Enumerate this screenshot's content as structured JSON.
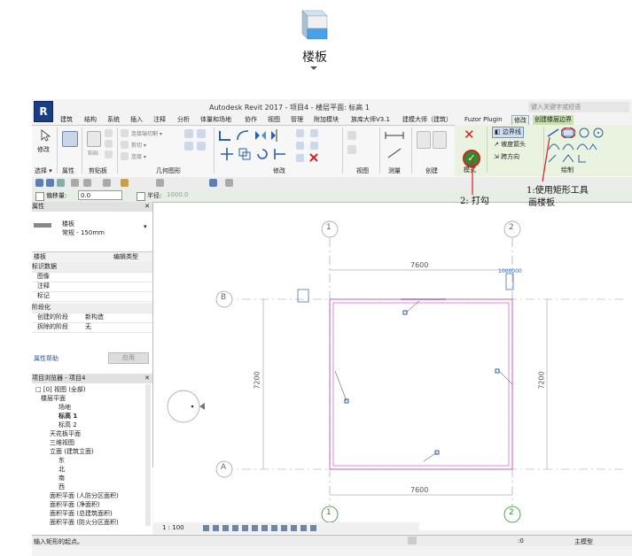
{
  "floor_tool": {
    "label": "楼板",
    "icon": "floor-slab-icon"
  },
  "window": {
    "title": "Autodesk Revit 2017 -    项目4 - 楼层平面: 标高 1",
    "search_placeholder": "键入关键字或短语"
  },
  "tabs": [
    "建筑",
    "结构",
    "系统",
    "插入",
    "注释",
    "分析",
    "体量和场地",
    "协作",
    "视图",
    "管理",
    "附加模块",
    "族库大师V3.1",
    "建模大师（建筑）",
    "Fuzor Plugin",
    "修改",
    "创建楼层边界"
  ],
  "ribbon": {
    "modify_label": "修改",
    "groups": [
      "选择 ▾",
      "属性",
      "剪贴板",
      "几何图形",
      "修改",
      "视图",
      "测量",
      "创建",
      "模式",
      "绘制"
    ],
    "clipboard_paste": "粘贴",
    "geometry_items": [
      "连接端切割 ▾",
      "剪切 ▾",
      "连接 ▾"
    ],
    "boundary_items": [
      "边界线",
      "坡度箭头",
      "跨方向"
    ]
  },
  "options": {
    "offset_label": "偏移量:",
    "offset_value": "0.0",
    "radius_label": "半径:",
    "radius_value": "1000.0"
  },
  "properties": {
    "header": "属性",
    "type_family": "楼板",
    "type_name": "常规 - 150mm",
    "selector": "楼板",
    "edit_type": "编辑类型",
    "sections": [
      {
        "title": "标识数据",
        "rows": [
          {
            "k": "图像",
            "v": ""
          },
          {
            "k": "注释",
            "v": ""
          },
          {
            "k": "标记",
            "v": ""
          }
        ]
      },
      {
        "title": "阶段化",
        "rows": [
          {
            "k": "创建的阶段",
            "v": "新构造"
          },
          {
            "k": "拆除的阶段",
            "v": "无"
          }
        ]
      }
    ],
    "help": "属性帮助",
    "apply": "应用"
  },
  "browser": {
    "header": "项目浏览器 - 项目4",
    "items": [
      "□ [0] 视图 (全部)",
      "楼层平面",
      "场地",
      "标高 1",
      "标高 2",
      "天花板平面",
      "三维视图",
      "立面 (建筑立面)",
      "东",
      "北",
      "南",
      "西",
      "面积平面 (人防分区面积)",
      "面积平面 (净面积)",
      "面积平面 (总建筑面积)",
      "面积平面 (防火分区面积)"
    ]
  },
  "canvas": {
    "grid_top": [
      "1",
      "2"
    ],
    "grid_bottom": [
      "1",
      "2"
    ],
    "grid_side": [
      "B",
      "A"
    ],
    "dim_top": "7600",
    "dim_bottom": "7600",
    "dim_left": "7200",
    "dim_right": "7200",
    "tag_value": "1000000"
  },
  "annotations": {
    "rect_tool": "1:使用矩形工具",
    "rect_tool2": "画楼板",
    "check": "2: 打勾"
  },
  "viewbar": {
    "scale": "1 : 100"
  },
  "status": {
    "hint": "输入矩形的起点。",
    "coord": ":0",
    "model": "主模型"
  },
  "colors": {
    "accent_blue": "#1b3d82",
    "context_green": "#c7e2b0",
    "sketch_magenta": "#d04ad0",
    "annotation_red": "#d42020"
  }
}
